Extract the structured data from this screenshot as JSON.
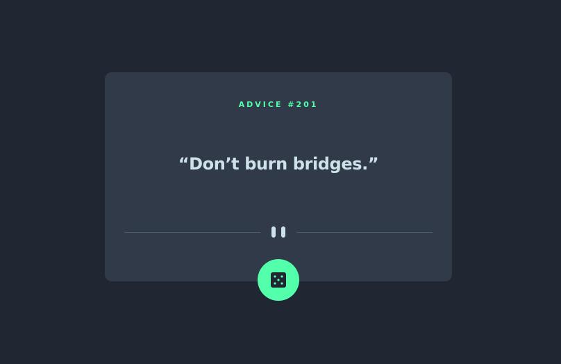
{
  "card": {
    "label": "ADVICE #201",
    "quote": "“Don’t burn bridges.”"
  },
  "divider": {
    "icon": "pause-icon"
  },
  "action": {
    "icon": "dice-icon"
  },
  "colors": {
    "background": "#202632",
    "card": "#313a48",
    "accent": "#53ffaa",
    "text": "#cee3e9",
    "divider": "#4f5d74"
  }
}
